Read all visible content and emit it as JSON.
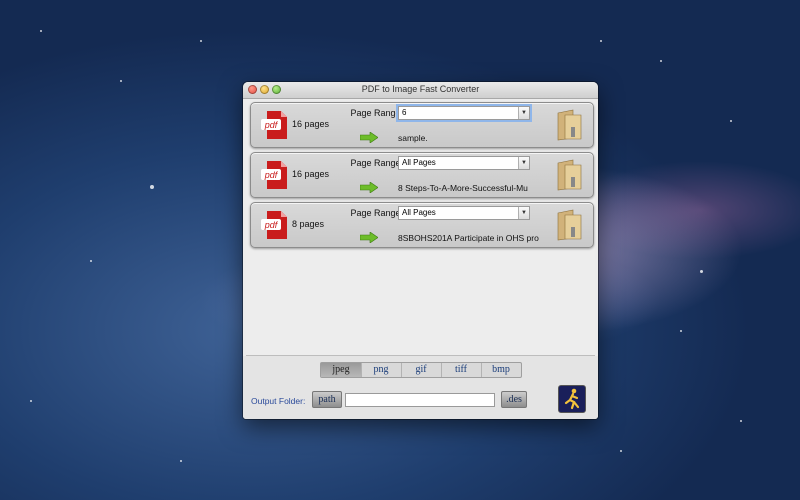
{
  "window": {
    "title": "PDF to Image Fast Converter"
  },
  "files": [
    {
      "pages_text": "16 pages",
      "range_label": "Page Range:",
      "range_value": "6",
      "filename": "sample."
    },
    {
      "pages_text": "16 pages",
      "range_label": "Page Range:",
      "range_value": "All Pages",
      "filename": "8 Steps-To-A-More-Successful-Mu"
    },
    {
      "pages_text": "8 pages",
      "range_label": "Page Range:",
      "range_value": "All Pages",
      "filename": "8SBOHS201A Participate in OHS pro"
    }
  ],
  "pdf_icon_text": "pdf",
  "formats": {
    "selected": "jpeg",
    "items": [
      "jpeg",
      "png",
      "gif",
      "tiff",
      "bmp"
    ]
  },
  "output": {
    "label": "Output Folder:",
    "path_button": "path",
    "des_button": ".des",
    "value": ""
  }
}
